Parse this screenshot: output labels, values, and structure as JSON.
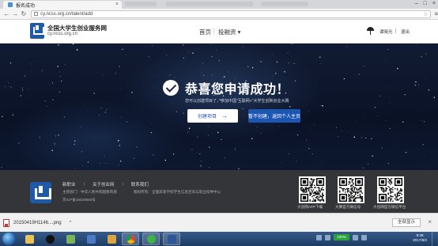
{
  "browser": {
    "tab_title": "报名成功",
    "url": "cy.ncss.org.cn/talent/add"
  },
  "header": {
    "site_name": "全国大学生创业服务网",
    "site_domain": "cy.ncss.org.cn",
    "nav": [
      {
        "label": "首页"
      },
      {
        "label": "投融资 ▾"
      }
    ],
    "username": "谭晓光",
    "logout": "退出"
  },
  "hero": {
    "title": "恭喜您申请成功！",
    "subtitle": "您可以创建项目了，参加中国\"互联网+\"大学生创新创业大赛",
    "create_button": "创建项目",
    "home_button": "暂不创建，返回个人主页"
  },
  "footer": {
    "links": [
      {
        "label": "新职业"
      },
      {
        "label": "关于创业网"
      },
      {
        "label": "联系我们"
      }
    ],
    "sponsor": "主管部门：中华人民共和国教育部",
    "icp": "京ICP备15029560号",
    "copyright": "版权所有：全国高等学校学生信息咨询与就业指导中心",
    "qr_codes": [
      {
        "label": "大创网APP下载"
      },
      {
        "label": "大赛官方微信号"
      },
      {
        "label": "大创网官方微信平台"
      }
    ]
  },
  "download_bar": {
    "file_name": "20150419H1146....png",
    "show_all": "全部显示"
  },
  "taskbar": {
    "battery": "100%",
    "time": "9:38",
    "date": "2017/6/2"
  }
}
